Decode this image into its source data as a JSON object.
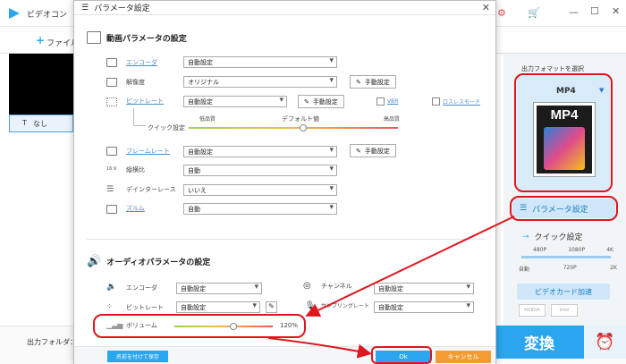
{
  "app": {
    "title": "ビデオコン",
    "add_file": "ファイル",
    "subtitle_none": "なし",
    "output_folder": "出力フォルダ：",
    "output_format_label": "出力フォマットを選択",
    "format_name": "MP4",
    "format_icon_text": "MP4",
    "param_button": "パラメータ設定",
    "quick_settings": "クイック設定",
    "quick_ticks_top": [
      "480P",
      "1080P",
      "4K"
    ],
    "quick_ticks_bottom": [
      "自動",
      "720P",
      "2K"
    ],
    "gpu_accel": "ビデオカード加速",
    "gpu_brands": [
      "NVIDIA",
      "Intel"
    ],
    "convert": "変換"
  },
  "dialog": {
    "title": "パラメータ設定",
    "video_section": "動画パラメータの設定",
    "audio_section": "オーディオパラメータの設定",
    "video_rows": [
      {
        "label": "エンコーダ",
        "value": "自動設定"
      },
      {
        "label": "解像度",
        "value": "オリジナル",
        "manual": "手動設定"
      },
      {
        "label": "ビットレート",
        "value": "自動設定",
        "manual": "手動設定"
      },
      {
        "label": "フレームレート",
        "value": "自動設定",
        "manual": "手動設定"
      },
      {
        "label": "縦横比",
        "value": "自動"
      },
      {
        "label": "デインターレース",
        "value": "いいえ"
      },
      {
        "label": "ズルム",
        "value": "自動"
      }
    ],
    "vbr": "VBR",
    "lossless": "ロスレスモード",
    "quick_setting": "クイック設定",
    "low_quality": "低品質",
    "default_value": "デフォルト値",
    "high_quality": "高品質",
    "audio_rows": [
      {
        "label": "エンコーダ",
        "value": "自動設定"
      },
      {
        "label": "ビットレート",
        "value": "自動設定"
      },
      {
        "label": "チャンネル",
        "value": "自動設定"
      },
      {
        "label": "サンプリングレート",
        "value": "自動設定"
      }
    ],
    "volume_label": "ボリューム",
    "volume_value": "120%",
    "volume_level": 0.6,
    "save_named": "名前を付けて保存",
    "ok": "Ok",
    "cancel": "キャンセル"
  },
  "colors": {
    "accent": "#2aa6ef",
    "cancel": "#f39c34",
    "highlight": "#e0161e"
  }
}
